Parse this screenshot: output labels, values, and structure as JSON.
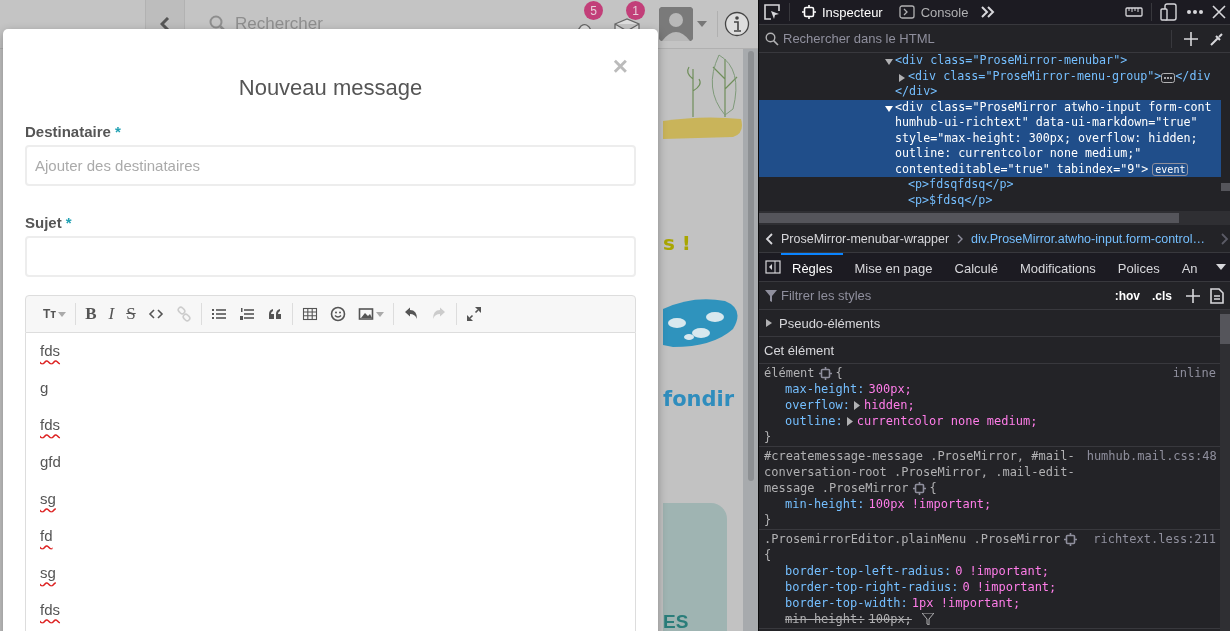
{
  "page": {
    "search": {
      "placeholder": "Rechercher"
    },
    "notifications": {
      "count": "5"
    },
    "messages": {
      "count": "1"
    },
    "headline_fragment": "s !",
    "link_fragment": "fondir",
    "card_fragment": "ES"
  },
  "modal": {
    "title": "Nouveau message",
    "close": "×",
    "fields": [
      {
        "label": "Destinataire",
        "required_mark": "*",
        "placeholder": "Ajouter des destinataires"
      },
      {
        "label": "Sujet",
        "required_mark": "*"
      }
    ],
    "toolbar": [
      [
        {
          "kind": "text-size",
          "glyph": "Tт",
          "dropdown": true,
          "disabled": false
        }
      ],
      [
        {
          "kind": "bold",
          "glyph": "B",
          "dropdown": false,
          "disabled": false
        },
        {
          "kind": "italic",
          "glyph": "I",
          "dropdown": false,
          "disabled": false
        },
        {
          "kind": "strike",
          "glyph": "S",
          "dropdown": false,
          "disabled": false
        },
        {
          "kind": "code",
          "dropdown": false,
          "disabled": false
        },
        {
          "kind": "link",
          "dropdown": false,
          "disabled": true
        }
      ],
      [
        {
          "kind": "bullet-list",
          "dropdown": false,
          "disabled": false
        },
        {
          "kind": "ordered-list",
          "dropdown": false,
          "disabled": false
        },
        {
          "kind": "quote",
          "dropdown": false,
          "disabled": false
        }
      ],
      [
        {
          "kind": "table",
          "dropdown": false,
          "disabled": false
        },
        {
          "kind": "emoji",
          "dropdown": false,
          "disabled": false
        },
        {
          "kind": "image",
          "dropdown": true,
          "disabled": false
        }
      ],
      [
        {
          "kind": "undo",
          "dropdown": false,
          "disabled": false
        },
        {
          "kind": "redo",
          "dropdown": false,
          "disabled": true
        }
      ],
      [
        {
          "kind": "fullscreen",
          "dropdown": false,
          "disabled": false
        }
      ]
    ],
    "lines": [
      {
        "text": "fds",
        "misspelled": true
      },
      {
        "text": "g",
        "misspelled": false
      },
      {
        "text": "fds",
        "misspelled": true
      },
      {
        "text": "gfd",
        "misspelled": false
      },
      {
        "text": "sg",
        "misspelled": true
      },
      {
        "text": "fd",
        "misspelled": true
      },
      {
        "text": "sg",
        "misspelled": true
      },
      {
        "text": "fds",
        "misspelled": true
      }
    ]
  },
  "devtools": {
    "tabs": [
      {
        "label": "Inspecteur",
        "kind": "inspector",
        "selected": true
      },
      {
        "label": "Console",
        "kind": "console",
        "selected": false
      }
    ],
    "html_search": {
      "placeholder": "Rechercher dans le HTML"
    },
    "html_tree": [
      {
        "lines": [
          "<div class=\"ProseMirror-menubar\">"
        ],
        "expanded": true,
        "selected": false,
        "children": [
          {
            "lines": [
              "<div class=\"ProseMirror-menu-group\">"
            ],
            "expanded": false,
            "selected": false,
            "collapsed_end": "</div"
          }
        ],
        "closing": "</div>"
      },
      {
        "lines": [
          "<div class=\"ProseMirror atwho-input form-cont",
          "humhub-ui-richtext\" data-ui-markdown=\"true\"",
          "style=\"max-height: 300px; overflow: hidden;",
          "outline: currentcolor none medium;\"",
          "contenteditable=\"true\" tabindex=\"9\">"
        ],
        "badge": "event",
        "expanded": true,
        "selected": true,
        "children": [
          {
            "lines": [
              "<p>fdsqfdsq</p>"
            ],
            "selected": false
          },
          {
            "lines": [
              "<p>$fdsq</p>"
            ],
            "selected": false
          }
        ]
      }
    ],
    "breadcrumbs": [
      {
        "label": "ProseMirror-menubar-wrapper",
        "selected": false
      },
      {
        "label": "div.ProseMirror.atwho-input.form-control…",
        "selected": true
      }
    ],
    "panel_tabs": [
      {
        "label": "Règles",
        "selected": true
      },
      {
        "label": "Mise en page",
        "selected": false
      },
      {
        "label": "Calculé",
        "selected": false
      },
      {
        "label": "Modifications",
        "selected": false
      },
      {
        "label": "Polices",
        "selected": false
      },
      {
        "label": "An",
        "selected": false
      }
    ],
    "filter": {
      "placeholder": "Filtrer les styles"
    },
    "toggles": [
      ":hov",
      ".cls"
    ],
    "pseudo_elements": {
      "label": "Pseudo-éléments",
      "expanded": false
    },
    "section_title": "Cet élément",
    "rules": [
      {
        "selector_lines": [
          "élément"
        ],
        "open_brace": "{",
        "brace_on_new_line": false,
        "source": "inline",
        "close_brace": "}",
        "declarations": [
          {
            "property": "max-height:",
            "value": "300px;",
            "expandable": false,
            "overridden": false
          },
          {
            "property": "overflow:",
            "value": "hidden;",
            "expandable": true,
            "overridden": false
          },
          {
            "property": "outline:",
            "value": "currentcolor none medium;",
            "expandable": true,
            "overridden": false
          }
        ]
      },
      {
        "selector_lines": [
          "#createmessage-message .ProseMirror, #mail-",
          "conversation-root .ProseMirror, .mail-edit-",
          "message .ProseMirror"
        ],
        "open_brace": "{",
        "brace_on_new_line": false,
        "source": "humhub.mail.css:48",
        "close_brace": "}",
        "declarations": [
          {
            "property": "min-height:",
            "value": "100px !important;",
            "expandable": false,
            "overridden": false
          }
        ]
      },
      {
        "selector_lines": [
          ".ProsemirrorEditor.plainMenu .ProseMirror"
        ],
        "open_brace": "{",
        "brace_on_new_line": true,
        "source": "richtext.less:211",
        "declarations": [
          {
            "property": "border-top-left-radius:",
            "value": "0 !important;",
            "expandable": false,
            "overridden": false
          },
          {
            "property": "border-top-right-radius:",
            "value": "0 !important;",
            "expandable": false,
            "overridden": false
          },
          {
            "property": "border-top-width:",
            "value": "1px !important;",
            "expandable": false,
            "overridden": false
          },
          {
            "property": "min-height:",
            "value": "100px;",
            "expandable": false,
            "overridden": true
          }
        ]
      }
    ]
  }
}
